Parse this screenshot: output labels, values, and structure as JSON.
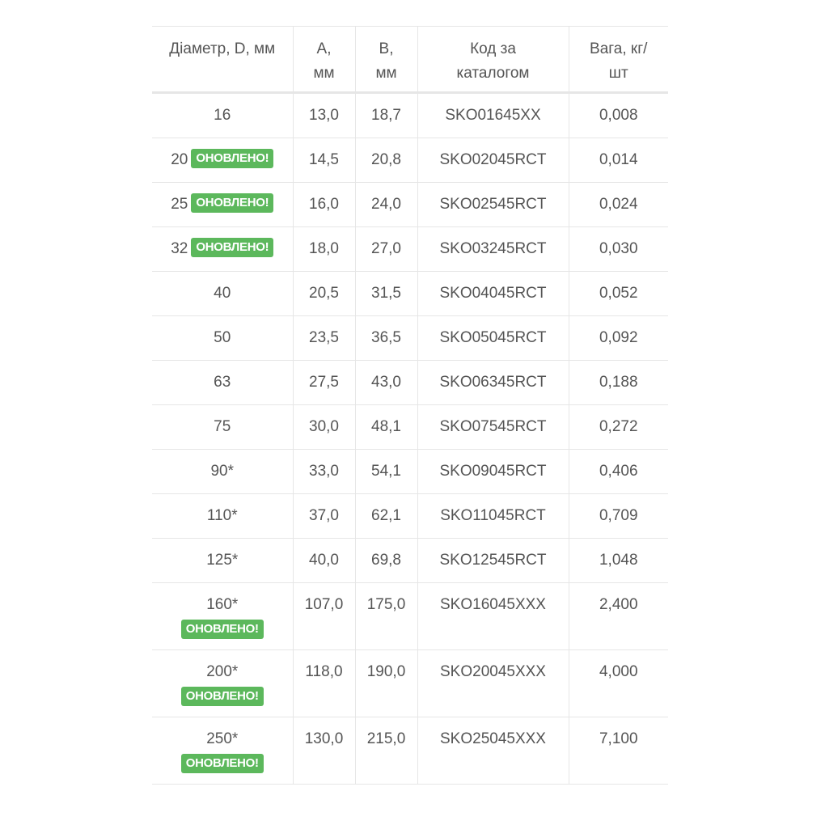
{
  "table": {
    "headers": [
      [
        "Діаметр, D, мм"
      ],
      [
        "A,",
        "мм"
      ],
      [
        "B,",
        "мм"
      ],
      [
        "Код за",
        "каталогом"
      ],
      [
        "Вага, кг/",
        "шт"
      ]
    ],
    "badge_label": "ОНОВЛЕНО!",
    "rows": [
      {
        "d": "16",
        "badge": false,
        "tall": false,
        "a": "13,0",
        "b": "18,7",
        "code": "SKO01645XX",
        "weight": "0,008"
      },
      {
        "d": "20",
        "badge": true,
        "tall": false,
        "a": "14,5",
        "b": "20,8",
        "code": "SKO02045RCT",
        "weight": "0,014"
      },
      {
        "d": "25",
        "badge": true,
        "tall": false,
        "a": "16,0",
        "b": "24,0",
        "code": "SKO02545RCT",
        "weight": "0,024"
      },
      {
        "d": "32",
        "badge": true,
        "tall": false,
        "a": "18,0",
        "b": "27,0",
        "code": "SKO03245RCT",
        "weight": "0,030"
      },
      {
        "d": "40",
        "badge": false,
        "tall": false,
        "a": "20,5",
        "b": "31,5",
        "code": "SKO04045RCT",
        "weight": "0,052"
      },
      {
        "d": "50",
        "badge": false,
        "tall": false,
        "a": "23,5",
        "b": "36,5",
        "code": "SKO05045RCT",
        "weight": "0,092"
      },
      {
        "d": "63",
        "badge": false,
        "tall": false,
        "a": "27,5",
        "b": "43,0",
        "code": "SKO06345RCT",
        "weight": "0,188"
      },
      {
        "d": "75",
        "badge": false,
        "tall": false,
        "a": "30,0",
        "b": "48,1",
        "code": "SKO07545RCT",
        "weight": "0,272"
      },
      {
        "d": "90*",
        "badge": false,
        "tall": false,
        "a": "33,0",
        "b": "54,1",
        "code": "SKO09045RCT",
        "weight": "0,406"
      },
      {
        "d": "110*",
        "badge": false,
        "tall": false,
        "a": "37,0",
        "b": "62,1",
        "code": "SKO11045RCT",
        "weight": "0,709"
      },
      {
        "d": "125*",
        "badge": false,
        "tall": false,
        "a": "40,0",
        "b": "69,8",
        "code": "SKO12545RCT",
        "weight": "1,048"
      },
      {
        "d": "160*",
        "badge": true,
        "tall": true,
        "a": "107,0",
        "b": "175,0",
        "code": "SKO16045XXX",
        "weight": "2,400"
      },
      {
        "d": "200*",
        "badge": true,
        "tall": true,
        "a": "118,0",
        "b": "190,0",
        "code": "SKO20045XXX",
        "weight": "4,000"
      },
      {
        "d": "250*",
        "badge": true,
        "tall": true,
        "a": "130,0",
        "b": "215,0",
        "code": "SKO25045XXX",
        "weight": "7,100"
      }
    ],
    "colors": {
      "badge_bg": "#5cb85c",
      "badge_text": "#ffffff",
      "text": "#555555",
      "border": "#e6e6e6"
    }
  }
}
